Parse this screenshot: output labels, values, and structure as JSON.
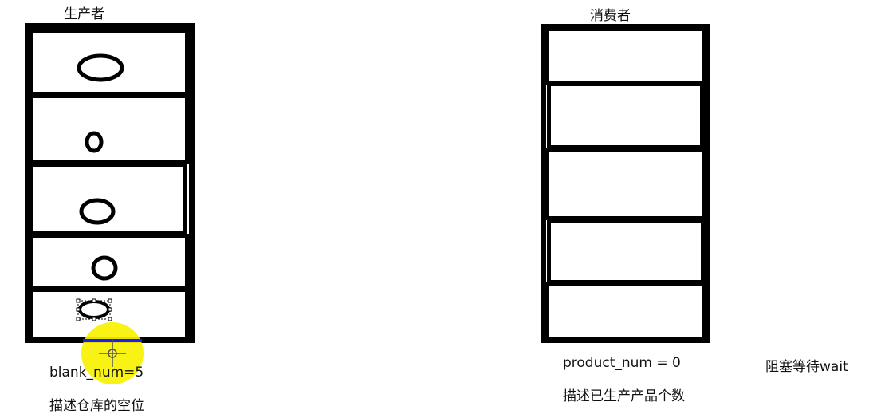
{
  "producer": {
    "title": "生产者",
    "counter_label": "blank_num=5",
    "description": "描述仓库的空位"
  },
  "consumer": {
    "title": "消费者",
    "counter_label": "product_num = 0",
    "description": "描述已生产产品个数",
    "status": "阻塞等待wait"
  },
  "colors": {
    "cursor_highlight": "#f7f200",
    "selection_line": "#1a1aff",
    "stroke": "#000000"
  }
}
